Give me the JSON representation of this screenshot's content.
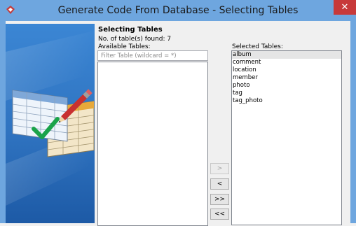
{
  "window": {
    "title": "Generate Code From Database - Selecting Tables",
    "close_glyph": "✕"
  },
  "page": {
    "heading": "Selecting Tables",
    "count_label": "No. of table(s) found: 7",
    "available_label": "Available Tables:",
    "filter_placeholder": "Filter Table (wildcard = *)",
    "selected_label": "Selected Tables:"
  },
  "selected_tables": [
    "album",
    "comment",
    "location",
    "member",
    "photo",
    "tag",
    "tag_photo"
  ],
  "buttons": {
    "add": ">",
    "remove": "<",
    "add_all": ">>",
    "remove_all": "<<"
  },
  "colors": {
    "titlebar": "#6ea6df",
    "close": "#c7393a",
    "banner_blue": "#2f73c0"
  },
  "icons": {
    "app": "app-logo-icon",
    "close": "close-icon"
  }
}
